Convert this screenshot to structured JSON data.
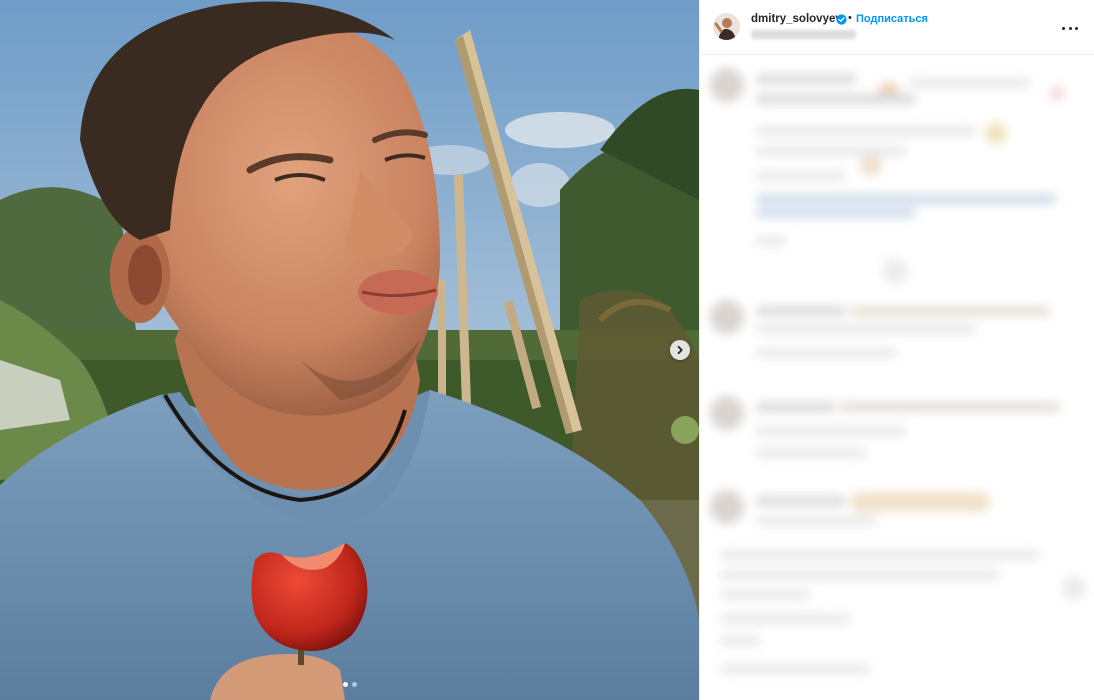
{
  "post": {
    "username": "dmitry_solovyev",
    "separator": "•",
    "follow_label": "Подписаться",
    "verified_icon": "verified-badge-icon",
    "more_icon": "more-horizontal-icon"
  },
  "carousel": {
    "next_icon": "chevron-right-icon",
    "slide_count": 2,
    "active_slide": 1
  },
  "colors": {
    "accent": "#0095f6",
    "verified": "#0095f6",
    "text": "#262626",
    "divider": "#efefef"
  }
}
